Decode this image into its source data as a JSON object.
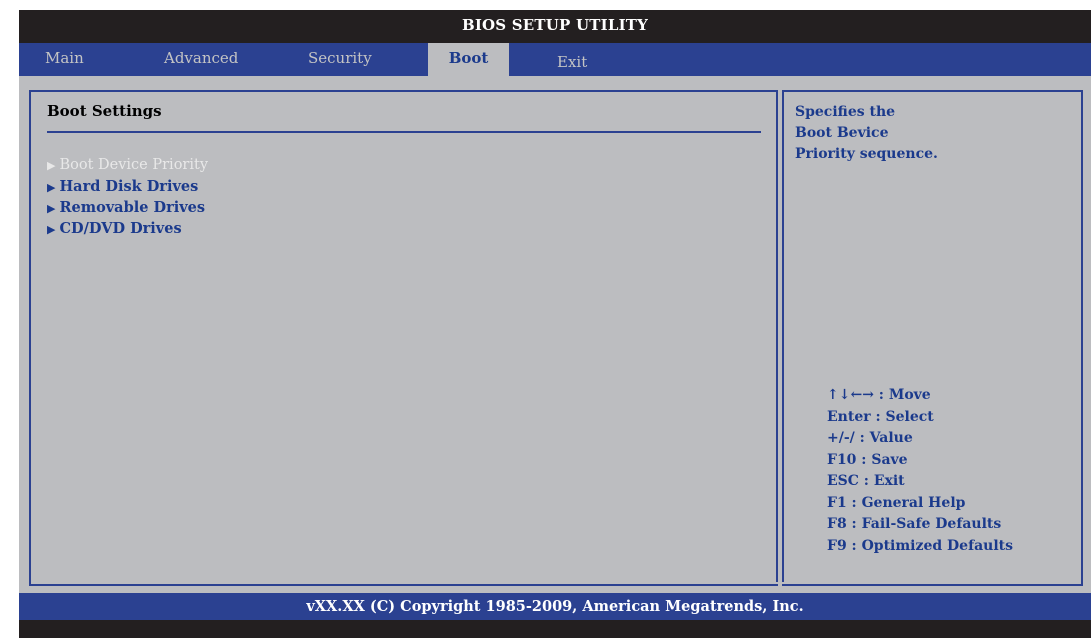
{
  "title": "BIOS SETUP UTILITY",
  "tabs": [
    {
      "label": "Main"
    },
    {
      "label": "Advanced"
    },
    {
      "label": "Security"
    },
    {
      "label": "Boot"
    },
    {
      "label": "Exit"
    }
  ],
  "active_tab": "Boot",
  "section": {
    "title": "Boot Settings",
    "items": [
      {
        "label": "Boot Device Priority",
        "state": "selected"
      },
      {
        "label": "Hard Disk Drives"
      },
      {
        "label": "Removable Drives"
      },
      {
        "label": "CD/DVD Drives"
      }
    ]
  },
  "help": {
    "lines": [
      "Specifies the",
      "Boot Bevice",
      "Priority sequence."
    ]
  },
  "keys": [
    {
      "label": "↑↓←→ : Move"
    },
    {
      "label": "Enter : Select"
    },
    {
      "label": "+/-/ : Value"
    },
    {
      "label": "F10 : Save"
    },
    {
      "label": "ESC : Exit"
    },
    {
      "label": "F1 : General Help"
    },
    {
      "label": "F8 : Fail-Safe Defaults"
    },
    {
      "label": "F9 : Optimized Defaults"
    }
  ],
  "footer": "vXX.XX (C) Copyright 1985-2009, American Megatrends, Inc.",
  "colors": {
    "frame": "#231f20",
    "accent_blue": "#2b4191",
    "panel_gray": "#bcbdc0",
    "text_blue": "#1b3a8c"
  },
  "icons": {
    "submenu": "triangle-right-icon"
  }
}
